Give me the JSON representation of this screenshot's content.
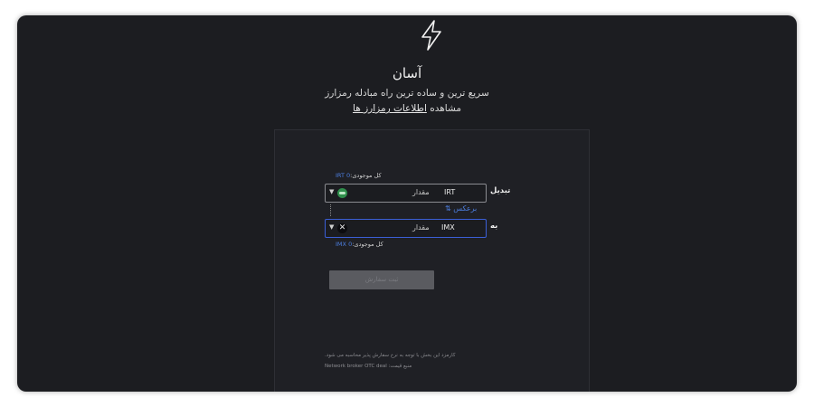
{
  "header": {
    "title": "آسان",
    "subtitle": "سریع ترین و ساده ترین راه مبادله رمزارز",
    "info_prefix": "مشاهده",
    "info_link": "اطلاعات رمزارز ها"
  },
  "form": {
    "from": {
      "balance_label": "کل موجودی:",
      "balance_value": "0 IRT",
      "label": "تبدیل",
      "currency": "IRT",
      "coin_icon": "irt-coin-icon",
      "placeholder": "مقدار"
    },
    "swap_label": "برعکس",
    "swap_icon": "⇅",
    "to": {
      "label": "به",
      "currency": "IMX",
      "coin_icon": "imx-coin-icon",
      "placeholder": "مقدار",
      "balance_label": "کل موجودی:",
      "balance_value": "0 IMX"
    },
    "submit_label": "ثبت سفارش"
  },
  "footer": {
    "fee_note": "کارمزد این بخش با توجه به نرخ سفارش پذیر محاسبه می شود.",
    "price_source": "منبع قیمت: Network broker OTC deal"
  },
  "colors": {
    "background": "#1c1d21",
    "accent": "#4c7ee0",
    "irt_coin": "#2f8f4c"
  }
}
